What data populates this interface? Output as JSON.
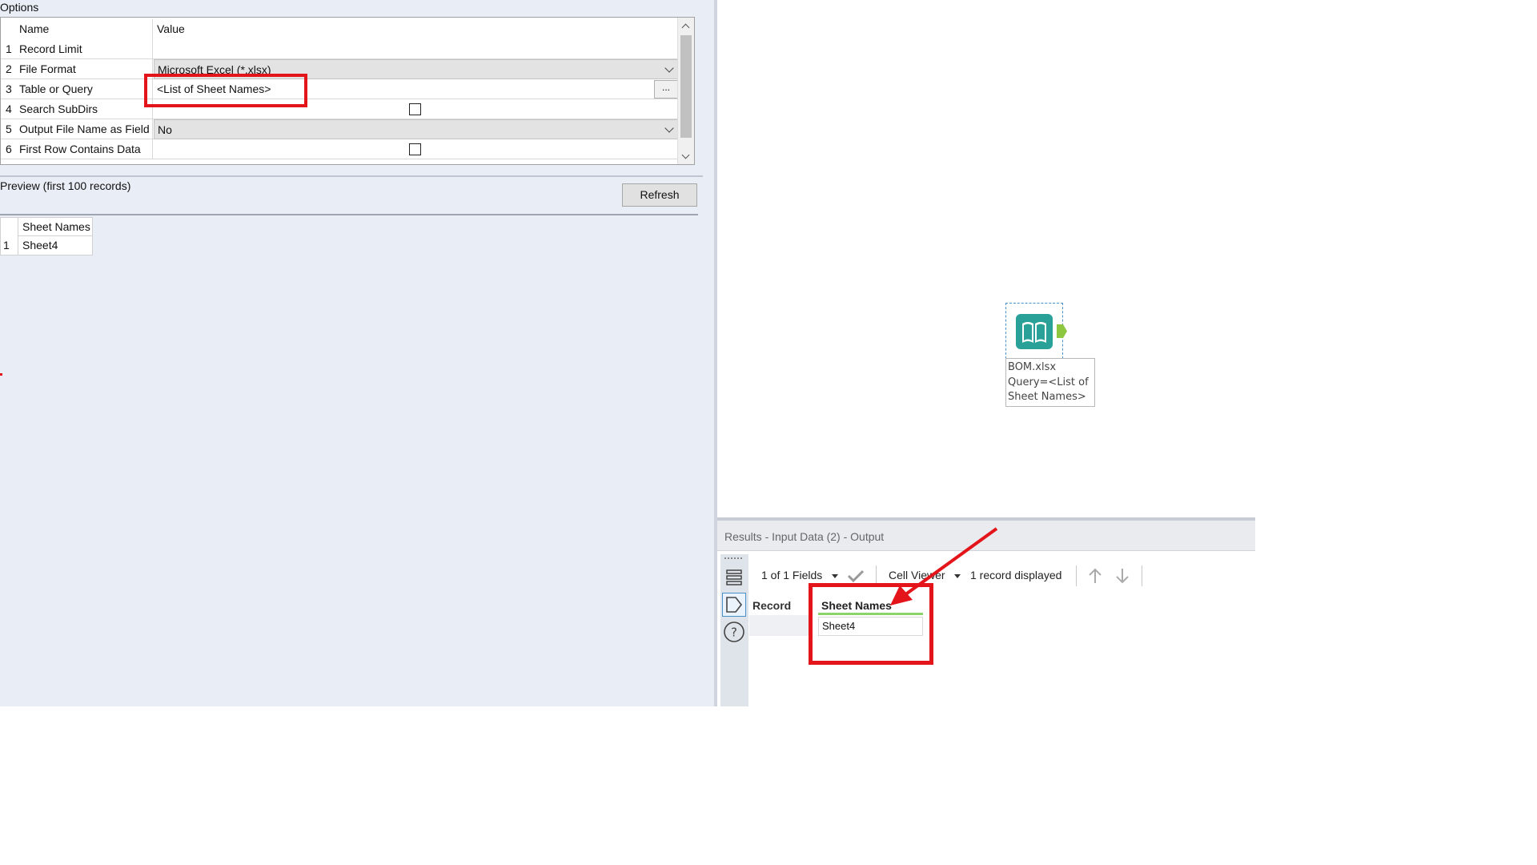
{
  "options": {
    "title": "Options",
    "col_name": "Name",
    "col_value": "Value",
    "rows": [
      {
        "num": "1",
        "name": "Record Limit",
        "value": ""
      },
      {
        "num": "2",
        "name": "File Format",
        "value": "Microsoft Excel (*.xlsx)"
      },
      {
        "num": "3",
        "name": "Table or Query",
        "value": "<List of Sheet Names>",
        "button": "..."
      },
      {
        "num": "4",
        "name": "Search SubDirs",
        "value": "",
        "checked": false
      },
      {
        "num": "5",
        "name": "Output File Name as Field",
        "value": "No"
      },
      {
        "num": "6",
        "name": "First Row Contains Data",
        "value": "",
        "checked": false
      }
    ]
  },
  "preview": {
    "label": "Preview (first 100 records)",
    "refresh_label": "Refresh",
    "table": {
      "header": "Sheet Names",
      "rows": [
        {
          "num": "1",
          "value": "Sheet4"
        }
      ]
    }
  },
  "canvas": {
    "tool": {
      "icon": "book-icon",
      "color": "#2aa198",
      "label_line1": "BOM.xlsx",
      "label_line2": "Query=<List of",
      "label_line3": "Sheet Names>"
    }
  },
  "results": {
    "title": "Results - Input Data (2) - Output",
    "toolbar": {
      "fields": "1 of 1 Fields",
      "cell_viewer": "Cell Viewer",
      "records": "1 record displayed"
    },
    "record_header": "Record",
    "column_header": "Sheet Names",
    "cells": [
      "Sheet4"
    ]
  },
  "annotation_color": "#e4141b"
}
